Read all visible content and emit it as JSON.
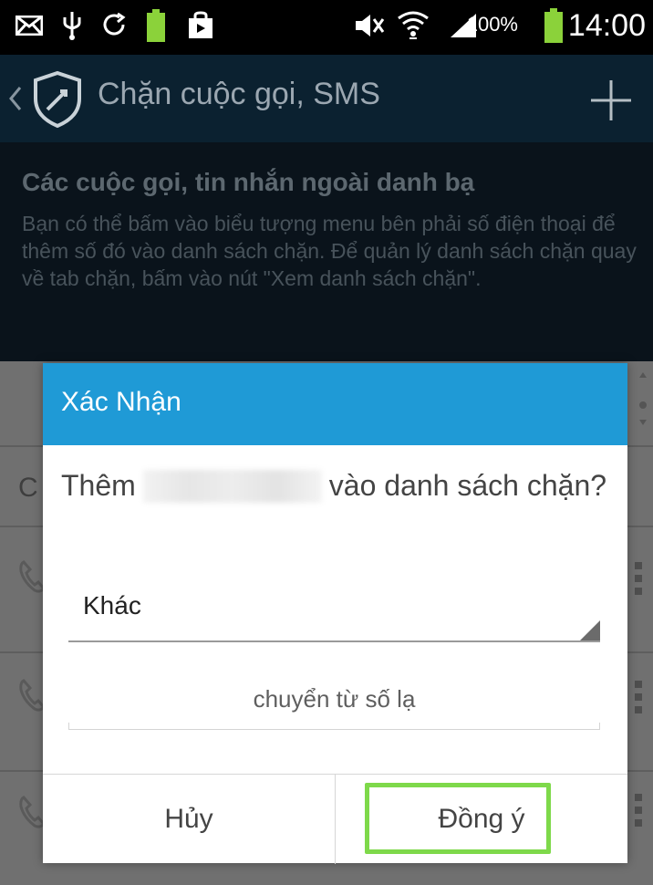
{
  "status_bar": {
    "icons": [
      "mail-icon",
      "usb-icon",
      "sync-icon",
      "battery-saver-icon",
      "bag-icon",
      "mute-icon",
      "wifi-icon",
      "signal-icon",
      "battery-icon"
    ],
    "battery_percent": "100%",
    "time": "14:00"
  },
  "action_bar": {
    "title": "Chặn cuộc gọi, SMS",
    "icons": [
      "back-chevron-icon",
      "shield-icon",
      "plus-icon"
    ]
  },
  "info": {
    "title": "Các cuộc gọi, tin nhắn ngoài danh bạ",
    "body": "Bạn có thể bấm vào biểu tượng menu bên phải số điện thoại để thêm số đó vào danh sách chặn. Để quản lý danh sách chặn quay về tab chặn, bấm vào nút \"Xem danh sách chặn\"."
  },
  "list": {
    "letter": "C"
  },
  "dialog": {
    "title": "Xác Nhận",
    "message_before": "Thêm",
    "message_after": "vào danh sách chặn?",
    "category_value": "Khác",
    "note_placeholder": "chuyển từ số lạ",
    "cancel_label": "Hủy",
    "ok_label": "Đồng ý"
  },
  "colors": {
    "dialog_header": "#1f9ad6",
    "highlight": "#7ed94a",
    "actionbar": "#0b2130"
  }
}
